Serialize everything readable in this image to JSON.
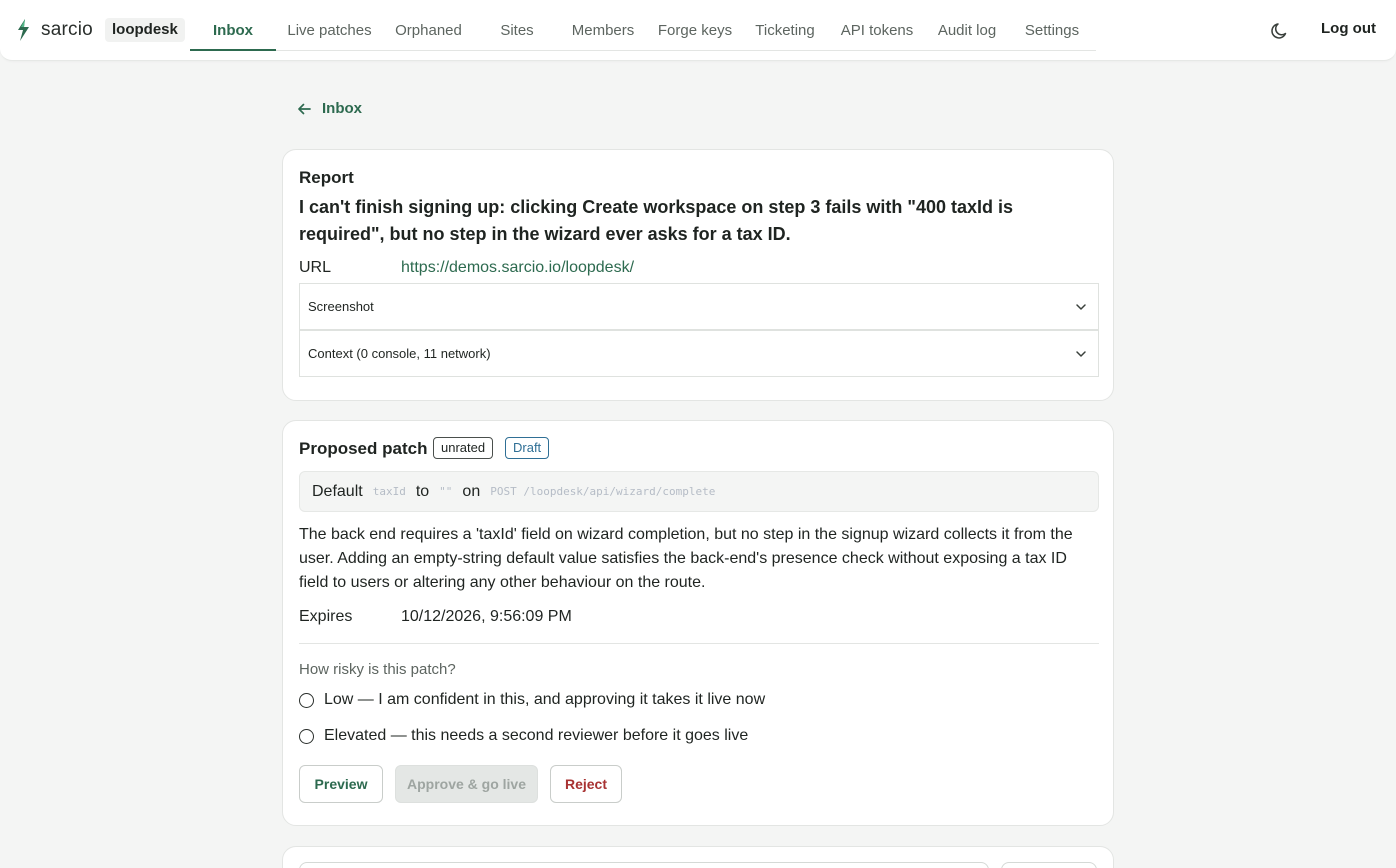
{
  "brand": {
    "name": "sarcio",
    "workspace": "loopdesk",
    "accent": "#2d6a4f"
  },
  "nav": {
    "items": [
      {
        "label": "Inbox",
        "active": true
      },
      {
        "label": "Live patches"
      },
      {
        "label": "Orphaned"
      },
      {
        "label": "Sites"
      },
      {
        "label": "Members"
      },
      {
        "label": "Forge keys"
      },
      {
        "label": "Ticketing"
      },
      {
        "label": "API tokens"
      },
      {
        "label": "Audit log"
      },
      {
        "label": "Settings"
      }
    ],
    "theme_icon": "moon-icon",
    "logout_label": "Log out"
  },
  "back": {
    "label": "Inbox"
  },
  "report": {
    "title": "Report",
    "message": "I can't finish signing up: clicking Create workspace on step 3 fails with \"400 taxId is required\", but no step in the wizard ever asks for a tax ID.",
    "url_label": "URL",
    "url_value": "https://demos.sarcio.io/loopdesk/",
    "screenshot_label": "Screenshot",
    "context_label": "Context (0 console, 11 network)"
  },
  "patch": {
    "title": "Proposed patch",
    "badge_rating": "unrated",
    "badge_status": "Draft",
    "summary": {
      "prefix": "Default",
      "field": "taxId",
      "to": "to",
      "value": "\"\"",
      "on": "on",
      "route": "POST /loopdesk/api/wizard/complete"
    },
    "description": "The back end requires a 'taxId' field on wizard completion, but no step in the signup wizard collects it from the user. Adding an empty-string default value satisfies the back-end's presence check without exposing a tax ID field to users or altering any other behaviour on the route.",
    "expires_label": "Expires",
    "expires_value": "10/12/2026, 9:56:09 PM",
    "risk_question": "How risky is this patch?",
    "risk_options": [
      "Low — I am confident in this, and approving it takes it live now",
      "Elevated — this needs a second reviewer before it goes live"
    ],
    "buttons": {
      "preview": "Preview",
      "approve": "Approve & go live",
      "reject": "Reject"
    }
  }
}
